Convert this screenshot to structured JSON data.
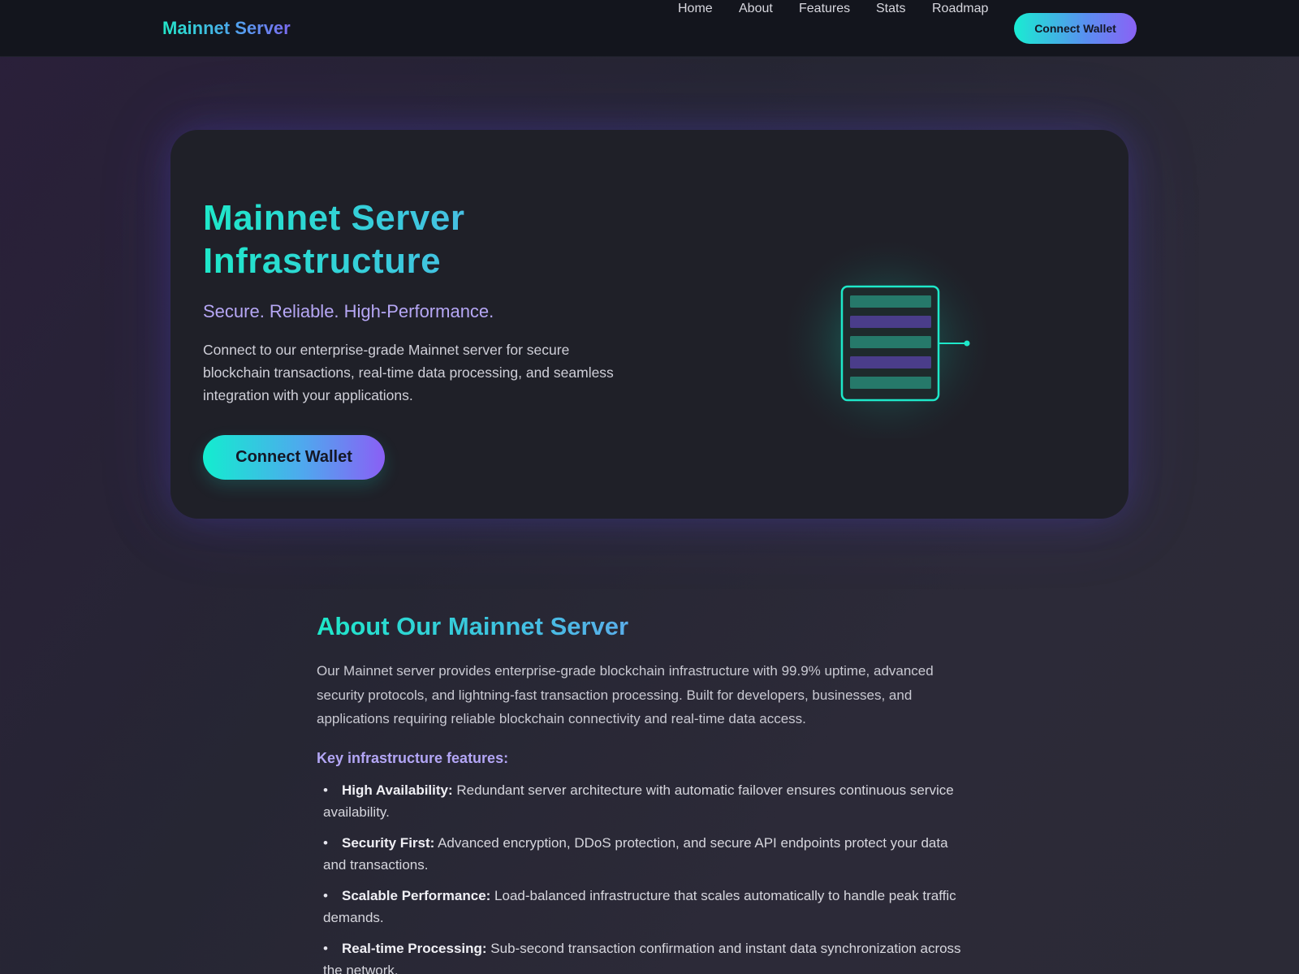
{
  "nav": {
    "brand": "Mainnet Server",
    "links": [
      "Home",
      "About",
      "Features",
      "Stats",
      "Roadmap"
    ],
    "cta_label": "Connect Wallet"
  },
  "hero": {
    "title_line1": "Mainnet Server",
    "title_line2": "Infrastructure",
    "tagline": "Secure. Reliable. High-Performance.",
    "description": "Connect to our enterprise-grade Mainnet server for secure blockchain transactions, real-time data processing, and seamless integration with your applications.",
    "cta_label": "Connect Wallet",
    "illustration_icon": "server-rack-icon"
  },
  "about": {
    "title": "About Our Mainnet Server",
    "text": "Our Mainnet server provides enterprise-grade blockchain infrastructure with 99.9% uptime, advanced security protocols, and lightning-fast transaction processing. Built for developers, businesses, and applications requiring reliable blockchain connectivity and real-time data access.",
    "features_heading": "Key infrastructure features:",
    "features": [
      {
        "name": "High Availability:",
        "text": " Redundant server architecture with automatic failover ensures continuous service availability."
      },
      {
        "name": "Security First:",
        "text": " Advanced encryption, DDoS protection, and secure API endpoints protect your data and transactions."
      },
      {
        "name": "Scalable Performance:",
        "text": " Load-balanced infrastructure that scales automatically to handle peak traffic demands."
      },
      {
        "name": "Real-time Processing:",
        "text": " Sub-second transaction confirmation and instant data synchronization across the network."
      }
    ]
  },
  "colors": {
    "accent_teal": "#1ee8c9",
    "accent_purple": "#8a5ff5",
    "tagline": "#b6a7f5",
    "background": "#262633",
    "card": "#1f2028"
  }
}
